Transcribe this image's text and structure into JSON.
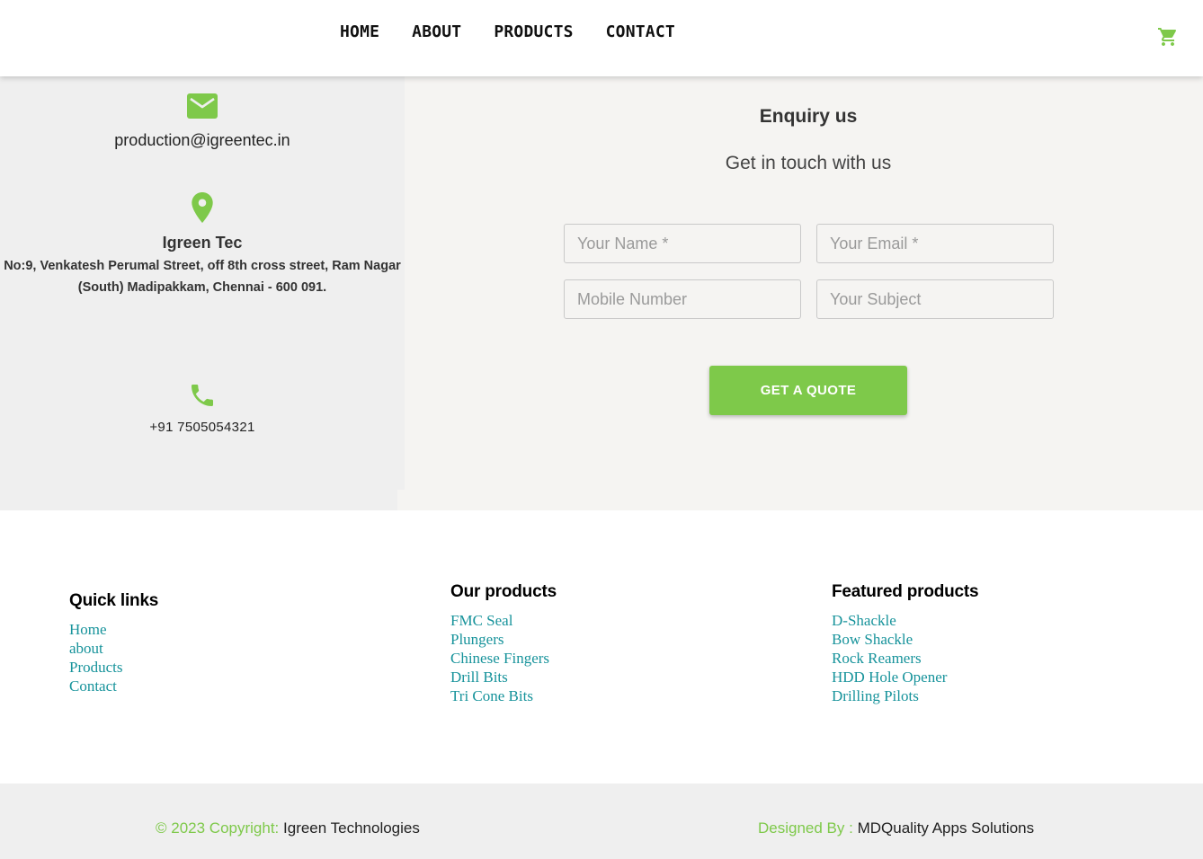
{
  "nav": {
    "items": [
      "HOME",
      "ABOUT",
      "PRODUCTS",
      "CONTACT"
    ]
  },
  "icons": {
    "cart": "cart-icon",
    "mail": "mail-icon",
    "location": "location-pin-icon",
    "phone": "phone-icon"
  },
  "colors": {
    "accent": "#7ec94a",
    "link": "#17939b",
    "panel": "#efefef",
    "section": "#f5f4f2"
  },
  "contact": {
    "email": "production@igreentec.in",
    "company": "Igreen Tec",
    "address_line1": "No:9, Venkatesh Perumal Street, off 8th cross street, Ram Nagar",
    "address_line2": "(South) Madipakkam, Chennai - 600 091.",
    "phone": "+91 7505054321"
  },
  "enquiry": {
    "title": "Enquiry us",
    "subtitle": "Get in touch with us",
    "name_placeholder": "Your Name *",
    "email_placeholder": "Your Email *",
    "mobile_placeholder": "Mobile Number",
    "subject_placeholder": "Your Subject",
    "button": "GET A QUOTE"
  },
  "footer": {
    "quick": {
      "title": "Quick links",
      "links": [
        "Home",
        "about",
        "Products",
        "Contact"
      ]
    },
    "ours": {
      "title": "Our products",
      "links": [
        "FMC Seal",
        "Plungers",
        "Chinese Fingers",
        "Drill Bits",
        "Tri Cone Bits"
      ]
    },
    "featured": {
      "title": "Featured products",
      "links": [
        "D-Shackle",
        "Bow Shackle",
        "Rock Reamers",
        "HDD Hole Opener",
        "Drilling Pilots"
      ]
    }
  },
  "bottom": {
    "copyright_label": "© 2023 Copyright:",
    "copyright_name": "Igreen Technologies",
    "designed_label": "Designed By :",
    "designed_name": "MDQuality Apps Solutions"
  }
}
